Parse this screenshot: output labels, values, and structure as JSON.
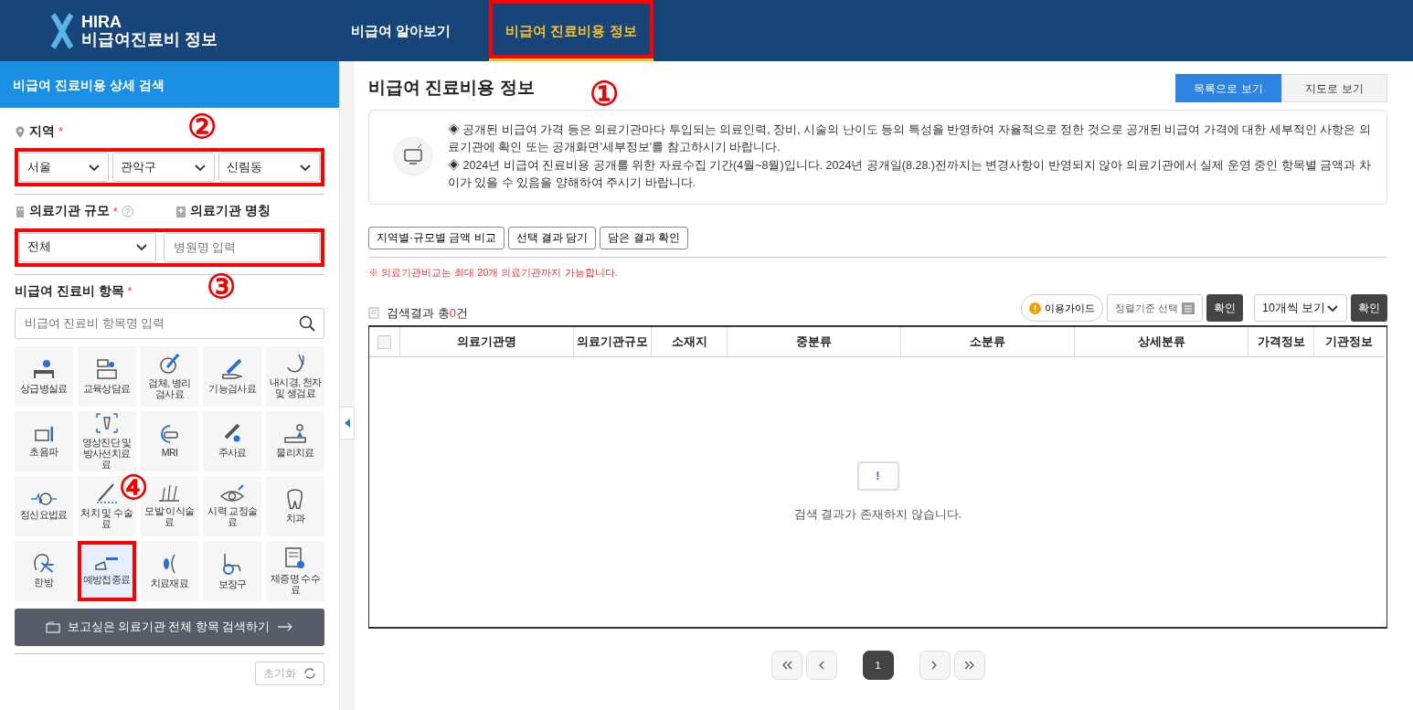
{
  "header": {
    "logo_mark": "HIRA",
    "logo_title": "비급여진료비 정보",
    "nav": [
      {
        "label": "비급여 알아보기",
        "selected": false,
        "highlighted": false
      },
      {
        "label": "비급여 진료비용 정보",
        "selected": true,
        "highlighted": true
      }
    ]
  },
  "sidebar": {
    "title": "비급여 진료비용 상세 검색",
    "region": {
      "label": "지역",
      "required": "*",
      "highlighted": true,
      "selects": [
        "서울",
        "관악구",
        "신림동"
      ]
    },
    "scale": {
      "label": "의료기관 규모",
      "required": "*",
      "value": "전체"
    },
    "name": {
      "label": "의료기관 명칭",
      "placeholder": "병원명 입력"
    },
    "scale_row_highlighted": true,
    "items": {
      "label": "비급여 진료비 항목",
      "required": "*",
      "placeholder": "비급여 진료비 항목명 입력"
    },
    "categories": [
      {
        "label": "상급병실료",
        "selected": false,
        "highlighted": false
      },
      {
        "label": "교육상담료",
        "selected": false,
        "highlighted": false
      },
      {
        "label": "검체, 병리 검사료",
        "selected": false,
        "highlighted": false
      },
      {
        "label": "기능검사료",
        "selected": false,
        "highlighted": false
      },
      {
        "label": "내시경, 천자 및 생검료",
        "selected": false,
        "highlighted": false
      },
      {
        "label": "초음파",
        "selected": false,
        "highlighted": false
      },
      {
        "label": "영상진단 및 방사선치료료",
        "selected": false,
        "highlighted": false
      },
      {
        "label": "MRI",
        "selected": false,
        "highlighted": false
      },
      {
        "label": "주사료",
        "selected": false,
        "highlighted": false
      },
      {
        "label": "물리치료",
        "selected": false,
        "highlighted": false
      },
      {
        "label": "정신요법료",
        "selected": false,
        "highlighted": false
      },
      {
        "label": "처치 및 수술료",
        "selected": false,
        "highlighted": false
      },
      {
        "label": "모발 이식술료",
        "selected": false,
        "highlighted": false
      },
      {
        "label": "시력 교정술료",
        "selected": false,
        "highlighted": false
      },
      {
        "label": "치과",
        "selected": false,
        "highlighted": false
      },
      {
        "label": "한방",
        "selected": false,
        "highlighted": false
      },
      {
        "label": "예방접종료",
        "selected": true,
        "highlighted": true
      },
      {
        "label": "치료재료",
        "selected": false,
        "highlighted": false
      },
      {
        "label": "보장구",
        "selected": false,
        "highlighted": false
      },
      {
        "label": "제증명 수수료",
        "selected": false,
        "highlighted": false
      }
    ],
    "search_all_button": "보고싶은 의료기관 전체 항목 검색하기",
    "reset_button": "초기화"
  },
  "main": {
    "title": "비급여 진료비용 정보",
    "view_toggle": [
      {
        "label": "목록으로 보기",
        "selected": true
      },
      {
        "label": "지도로 보기",
        "selected": false
      }
    ],
    "notices": [
      "◈ 공개된 비급여 가격 등은 의료기관마다 투입되는 의료인력, 장비, 시술의 난이도 등의 특성을 반영하여 자율적으로 정한 것으로 공개된 비급여 가격에 대한 세부적인 사항은 의료기관에 확인 또는 공개화면'세부정보'를 참고하시기 바랍니다.",
      "◈ 2024년 비급여 진료비용 공개를 위한 자료수집 기간(4월~8월)입니다. 2024년 공개일(8.28.)전까지는 변경사항이 반영되지 않아 의료기관에서 실제 운영 중인 항목별 금액과 차이가 있을 수 있음을 양해하여 주시기 바랍니다."
    ],
    "action_buttons": [
      "지역별·규모별 금액 비교",
      "선택 결과 담기",
      "담은 결과 확인"
    ],
    "compare_note": "※ 의료기관비교는 최대 20개 의료기관까지 가능합니다.",
    "result_count": "검색결과 총**0**건",
    "guide_button": "이용가이드",
    "sort_button": "정렬기준 선택",
    "confirm_button": "확인",
    "page_size": "10개씩 보기",
    "confirm_button_2": "확인",
    "table": {
      "select_all_checked": false,
      "columns": [
        "의료기관명",
        "의료기관규모",
        "소재지",
        "중분류",
        "소분류",
        "상세분류",
        "가격정보",
        "기관정보"
      ]
    },
    "empty_message": "검색 결과가 존재하지 않습니다.",
    "empty_mark": "!",
    "pagination": {
      "pages": [
        {
          "label": "1",
          "selected": true
        }
      ]
    }
  },
  "annotations": [
    {
      "label": "①"
    },
    {
      "label": "②"
    },
    {
      "label": "③"
    },
    {
      "label": "④"
    }
  ]
}
